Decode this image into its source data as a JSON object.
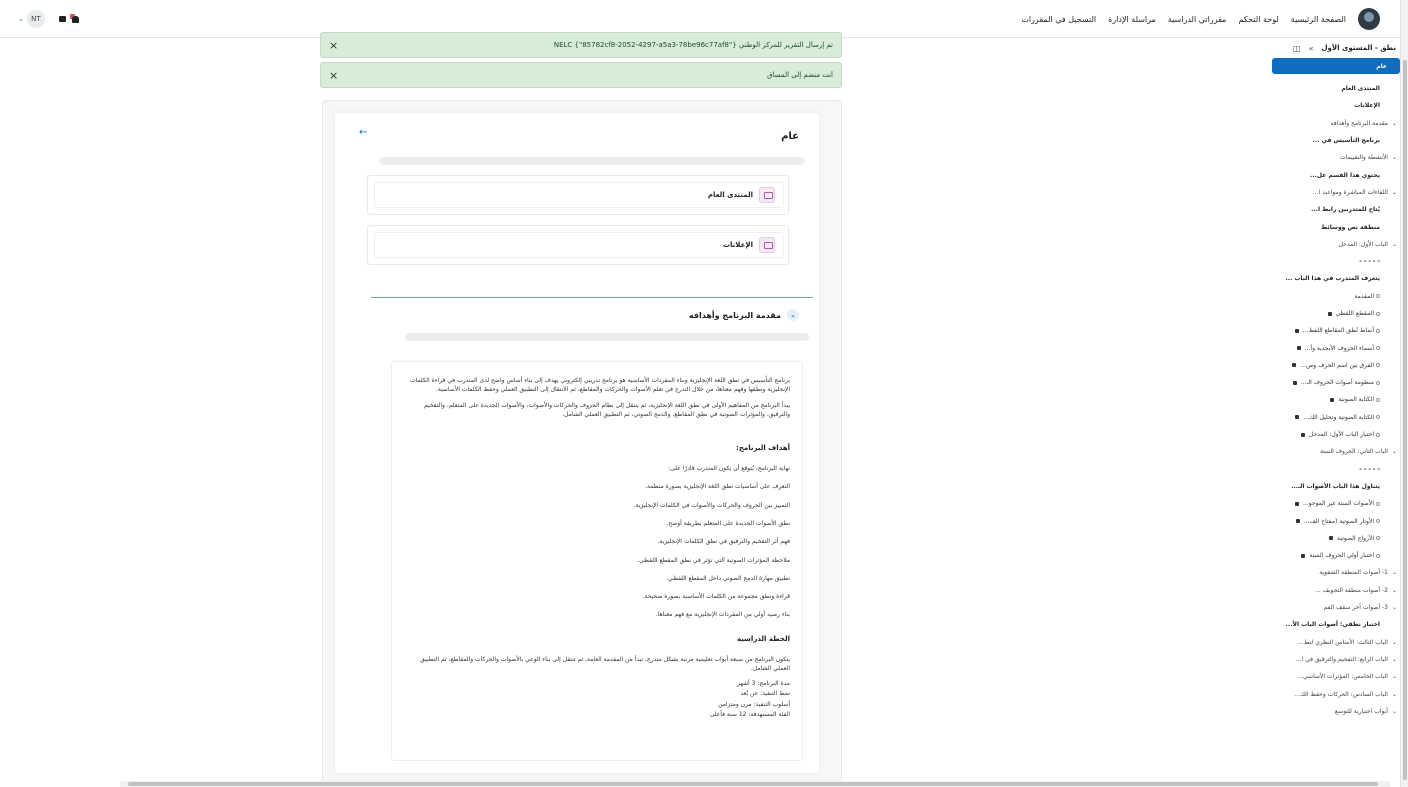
{
  "navbar": {
    "links": [
      "الصفحة الرئيسية",
      "لوحة التحكم",
      "مقرراتي الدراسية",
      "مراسلة الإدارة",
      "التسجيل في المقررات"
    ],
    "user_initials": "NT",
    "colors": {
      "accent": "#0f6cbf",
      "alert_bg": "#d7ecd9"
    }
  },
  "alerts": [
    {
      "text": "تم إرسال التقرير للمركز الوطني {\"85782cf8-2052-4297-a5a3-78be96c77af8\"} NELC",
      "close": "×"
    },
    {
      "text": "أنت منضم إلى المساق",
      "close": "×"
    }
  ],
  "main": {
    "section_title": "عام",
    "back_arrow": "←",
    "activities": [
      "المنتدى العام",
      "الإعلانات"
    ],
    "intro_section_title": "مقدمة البرنامج وأهدافه",
    "expand_icon": "chevron-down-icon",
    "summary": {
      "p1": "برنامج التأسيس في نطق اللغة الإنجليزية وبناء المفردات الأساسية هو برنامج تدريبي إلكتروني يهدف إلى بناء أساس واضح لدى المتدرب في قراءة الكلمات الإنجليزية ونطقها وفهم معناها، من خلال التدرج في تعلم الأصوات والحركات والمقاطع، ثم الانتقال إلى التطبيق العملي وحفظ الكلمات الأساسية.",
      "p2": "يبدأ البرنامج من المفاهيم الأولى في نطق اللغة الإنجليزية، ثم ينتقل إلى نظام الحروف والحركات والأصوات، والأصوات الجديدة على المتعلم، والتفخيم والترقيق، والمؤثرات الصوتية في نطق المقاطع، والدمج الصوتي، ثم التطبيق العملي الشامل.",
      "goals_title": "أهداف البرنامج:",
      "goals": [
        "نهاية البرنامج، يُتوقع أن يكون المتدرب قادرًا على:",
        "التعرف على أساسيات نطق اللغة الإنجليزية بصورة منظمة.",
        "التمييز بين الحروف والحركات والأصوات في الكلمات الإنجليزية.",
        "نطق الأصوات الجديدة على المتعلم بطريقة أوضح.",
        "فهم أثر التفخيم والترقيق في نطق الكلمات الإنجليزية.",
        "ملاحظة المؤثرات الصوتية التي تؤثر في نطق المقطع اللفظي.",
        "تطبيق مهارة الدمج الصوتي داخل المقطع اللفظي.",
        "قراءة ونطق مجموعة من الكلمات الأساسية بصورة صحيحة.",
        "بناء رصيد أولي من المفردات الإنجليزية مع فهم معناها."
      ],
      "plan_title": "الخطة الدراسية",
      "plan_intro": "يتكون البرنامج من سبعة أبواب تعليمية مرتبة بشكل متدرج، تبدأ من المقدمة العامة، ثم تنتقل إلى بناء الوعي بالأصوات والحركات والمقاطع، ثم التطبيق العملي الشامل.",
      "plan_lines": [
        "مدة البرنامج: 3 أشهر",
        "نمط التنفيذ: عن بُعد",
        "أسلوب التنفيذ: مرن ومتزامن",
        "الفئة المستهدفة: 12 سنة فأعلى"
      ]
    }
  },
  "drawer": {
    "title": "نطق - المستوى الأول",
    "collapse_icon": "chevron-double-down-icon",
    "close_icon": "panel-close-icon",
    "items": [
      {
        "label": "عام",
        "type": "active"
      },
      {
        "label": "المنتدى العام",
        "type": "child"
      },
      {
        "label": "الإعلانات",
        "type": "child"
      },
      {
        "label": "مقدمة البرنامج وأهدافه",
        "type": "section"
      },
      {
        "label": "برنامج التأسيس في ...",
        "type": "child"
      },
      {
        "label": "الأنشطة والتقييمات",
        "type": "section"
      },
      {
        "label": "يحتوي هذا القسم عل...",
        "type": "child"
      },
      {
        "label": "اللقاءات المباشرة ومواعيد ا...",
        "type": "section"
      },
      {
        "label": "يُتاح للمتدربين رابط ا...",
        "type": "child"
      },
      {
        "label": "منطقة نص ووسائط",
        "type": "child"
      },
      {
        "label": "الباب الأول: المدخل",
        "type": "section"
      },
      {
        "label": "- - - - -",
        "type": "child"
      },
      {
        "label": "يتعرف المتدرب في هذا الباب ...",
        "type": "child"
      },
      {
        "label": "المقدمة",
        "type": "activity"
      },
      {
        "label": "المقطع اللفظي",
        "type": "activity"
      },
      {
        "label": "أنماط نُطق المقاطع اللفظ...",
        "type": "activity"
      },
      {
        "label": "أسماء الحروف الأبجدية وأ...",
        "type": "activity"
      },
      {
        "label": "الفرق بين اسم الحرف وص...",
        "type": "activity"
      },
      {
        "label": "منظومة أصوات الحروف الـ...",
        "type": "activity"
      },
      {
        "label": "الكتابة الصوتية",
        "type": "activity"
      },
      {
        "label": "الكتابة الصوتية وتحليل الك...",
        "type": "activity"
      },
      {
        "label": "اختبار الباب الأول: المدخل",
        "type": "activity"
      },
      {
        "label": "الباب الثاني: الحروف الستة",
        "type": "section"
      },
      {
        "label": "- - - - -",
        "type": "child"
      },
      {
        "label": "يتناول هذا الباب الأصوات الـ...",
        "type": "child"
      },
      {
        "label": "الأصوات الستة غير الموجو...",
        "type": "activity"
      },
      {
        "label": "الأوتار الصوتية (مفتاح الف...",
        "type": "activity"
      },
      {
        "label": "الأزواج الصوتية",
        "type": "activity"
      },
      {
        "label": "اختبار أولي الحروف الستة",
        "type": "activity"
      },
      {
        "label": "1- أصوات المنطقة الشفوية",
        "type": "section"
      },
      {
        "label": "2- أصوات منطقة التجويف ...",
        "type": "section"
      },
      {
        "label": "3- أصوات آخر سقف الفم",
        "type": "section"
      },
      {
        "label": "اختبار نطقي: أصوات الباب الأ...",
        "type": "child"
      },
      {
        "label": "الباب الثالث: الأساس النظري لنط...",
        "type": "section"
      },
      {
        "label": "الباب الرابع: التفخيم والترقيق في ا...",
        "type": "section"
      },
      {
        "label": "الباب الخامس: المؤثرات الأساسي...",
        "type": "section"
      },
      {
        "label": "الباب السادس: الحركات وحفظ الك...",
        "type": "section"
      },
      {
        "label": "أبواب اختيارية للتوسع",
        "type": "section"
      }
    ]
  }
}
